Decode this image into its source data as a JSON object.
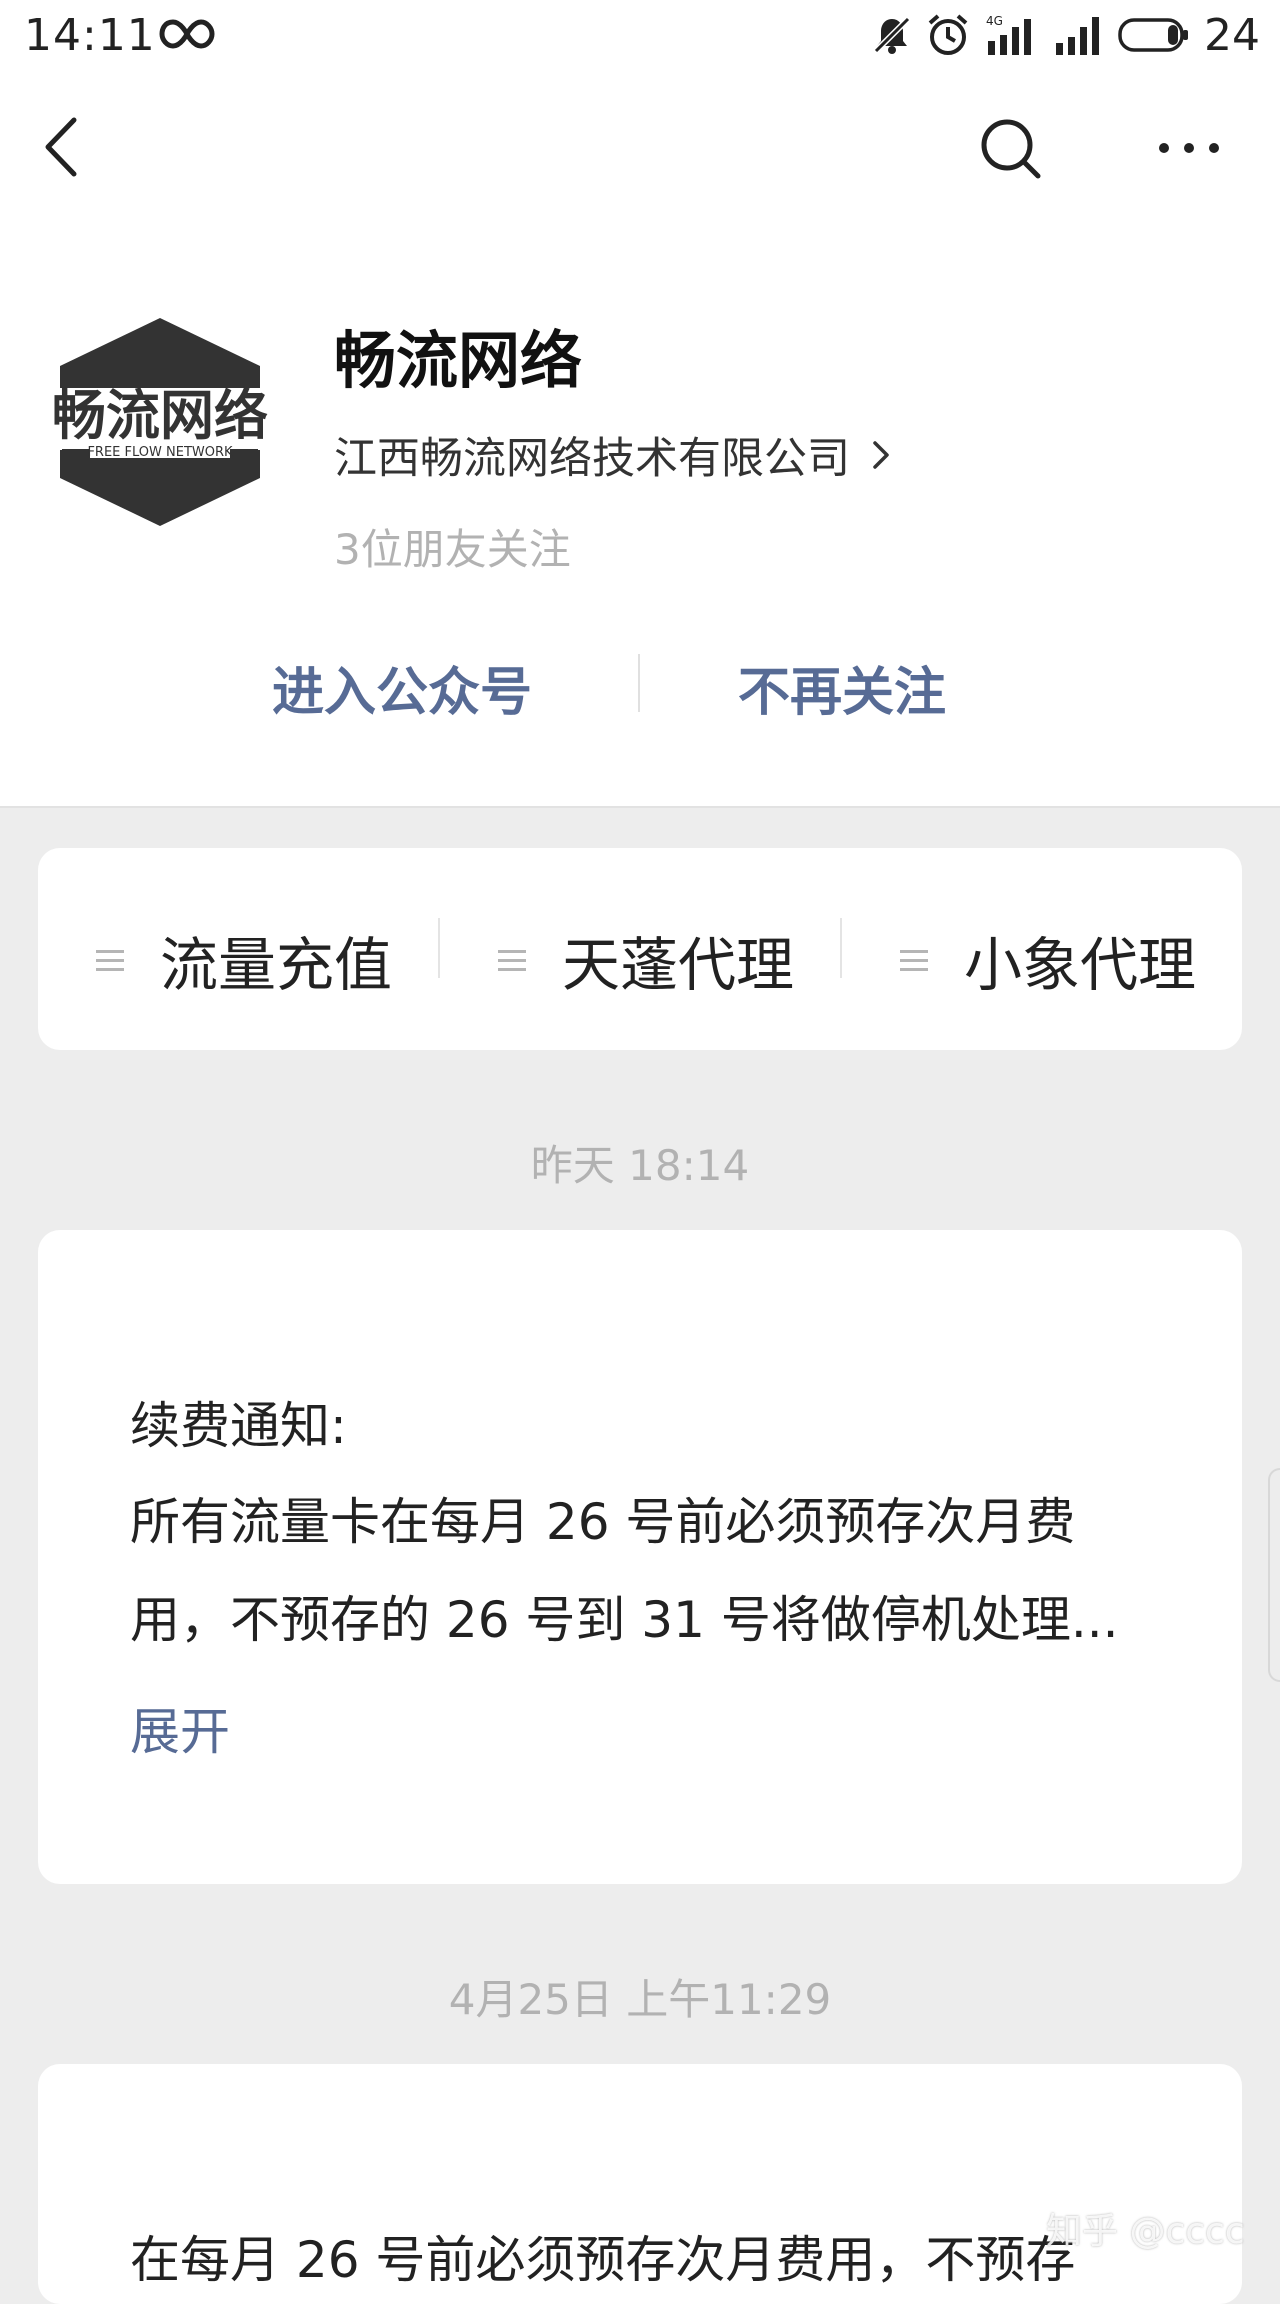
{
  "status_bar": {
    "time": "14:11",
    "battery": "24",
    "network": "4G"
  },
  "account": {
    "logo_text": "畅流网络",
    "logo_subtext": "FREE FLOW NETWORK",
    "name": "畅流网络",
    "company": "江西畅流网络技术有限公司",
    "friends_follow": "3位朋友关注"
  },
  "actions": {
    "enter": "进入公众号",
    "unfollow": "不再关注"
  },
  "menu": {
    "items": [
      {
        "label": "流量充值"
      },
      {
        "label": "天蓬代理"
      },
      {
        "label": "小象代理"
      }
    ]
  },
  "messages": [
    {
      "timestamp": "昨天 18:14",
      "title": "续费通知:",
      "lines": [
        "所有流量卡在每月 26 号前必须预存次月费",
        "用，不预存的 26 号到 31 号将做停机处理..."
      ],
      "expand": "展开"
    },
    {
      "timestamp": "4月25日 上午11:29",
      "lines": [
        "在每月 26 号前必须预存次月费用，不预存"
      ]
    }
  ],
  "watermark": "知乎 @cccc",
  "colors": {
    "link": "#576b95",
    "muted": "#b2b2b2",
    "background": "#ededed"
  }
}
